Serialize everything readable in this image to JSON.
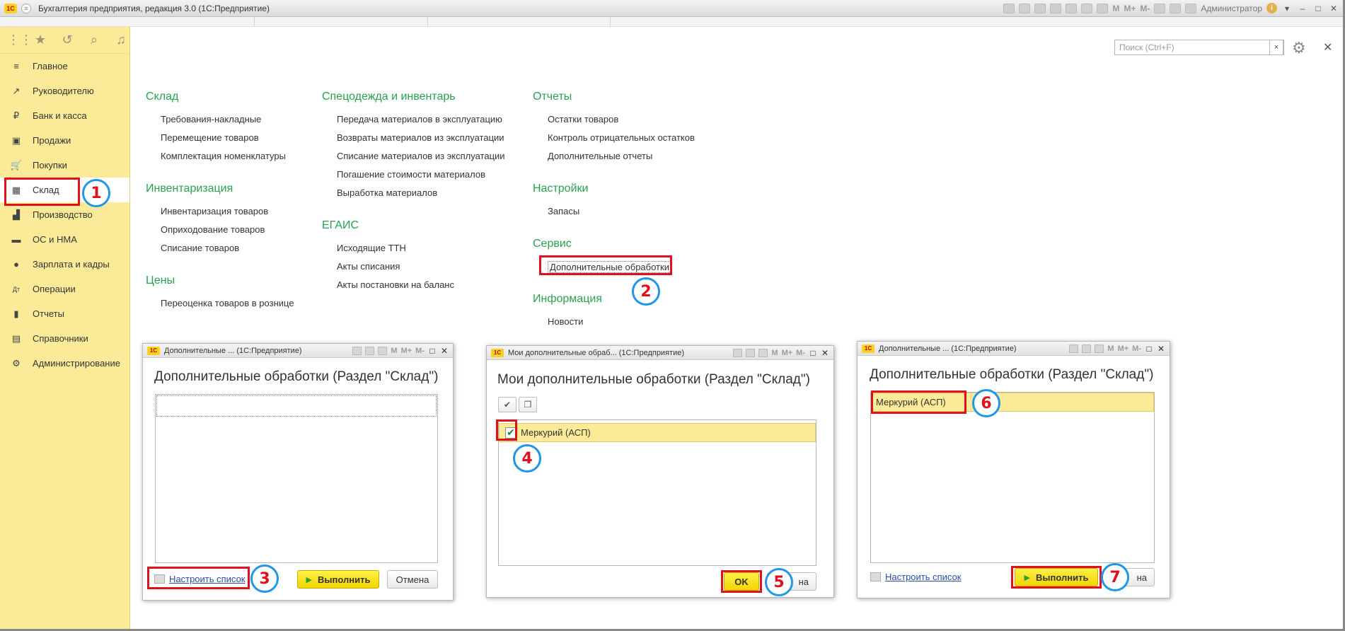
{
  "app": {
    "title": "Бухгалтерия предприятия, редакция 3.0  (1С:Предприятие)",
    "user": "Администратор",
    "logo": "1С",
    "toolbar_m": [
      "M",
      "M+",
      "M-"
    ]
  },
  "search": {
    "placeholder": "Поиск (Ctrl+F)",
    "clear": "×"
  },
  "sidebar": {
    "items": [
      {
        "label": "Главное",
        "icon": "≡"
      },
      {
        "label": "Руководителю",
        "icon": "↗"
      },
      {
        "label": "Банк и касса",
        "icon": "₽"
      },
      {
        "label": "Продажи",
        "icon": "▣"
      },
      {
        "label": "Покупки",
        "icon": "🛒"
      },
      {
        "label": "Склад",
        "icon": "▦"
      },
      {
        "label": "Производство",
        "icon": "▟"
      },
      {
        "label": "ОС и НМА",
        "icon": "▬"
      },
      {
        "label": "Зарплата и кадры",
        "icon": "●"
      },
      {
        "label": "Операции",
        "icon": "Дт"
      },
      {
        "label": "Отчеты",
        "icon": "▮"
      },
      {
        "label": "Справочники",
        "icon": "▤"
      },
      {
        "label": "Администрирование",
        "icon": "⚙"
      }
    ]
  },
  "menu": {
    "sklad": {
      "title": "Склад",
      "links": [
        "Требования-накладные",
        "Перемещение товаров",
        "Комплектация номенклатуры"
      ]
    },
    "inventar": {
      "title": "Инвентаризация",
      "links": [
        "Инвентаризация товаров",
        "Оприходование товаров",
        "Списание товаров"
      ]
    },
    "ceny": {
      "title": "Цены",
      "links": [
        "Переоценка товаров в рознице"
      ]
    },
    "specodezhda": {
      "title": "Спецодежда и инвентарь",
      "links": [
        "Передача материалов в эксплуатацию",
        "Возвраты материалов из эксплуатации",
        "Списание материалов из эксплуатации",
        "Погашение стоимости материалов",
        "Выработка материалов"
      ]
    },
    "egais": {
      "title": "ЕГАИС",
      "links": [
        "Исходящие ТТН",
        "Акты списания",
        "Акты постановки на баланс"
      ]
    },
    "otchety": {
      "title": "Отчеты",
      "links": [
        "Остатки товаров",
        "Контроль отрицательных остатков",
        "Дополнительные отчеты"
      ]
    },
    "nastroiki": {
      "title": "Настройки",
      "links": [
        "Запасы"
      ]
    },
    "servis": {
      "title": "Сервис",
      "links": [
        "Дополнительные обработки"
      ]
    },
    "info": {
      "title": "Информация",
      "links": [
        "Новости"
      ]
    }
  },
  "steps": [
    "1",
    "2",
    "3",
    "4",
    "5",
    "6",
    "7"
  ],
  "dialog1": {
    "window_title": "Дополнительные ...  (1С:Предприятие)",
    "heading": "Дополнительные обработки (Раздел \"Склад\")",
    "link": "Настроить список",
    "run_button": "Выполнить",
    "cancel_button": "Отмена"
  },
  "dialog2": {
    "window_title": "Мои дополнительные обраб...  (1С:Предприятие)",
    "heading": "Мои дополнительные обработки (Раздел \"Склад\")",
    "row": "Меркурий (АСП)",
    "checked": true,
    "ok_button": "OK",
    "cancel_partial": "на"
  },
  "dialog3": {
    "window_title": "Дополнительные ...  (1С:Предприятие)",
    "heading": "Дополнительные обработки (Раздел \"Склад\")",
    "row": "Меркурий (АСП)",
    "link": "Настроить список",
    "run_button": "Выполнить",
    "cancel_partial": "на"
  },
  "colors": {
    "sidebar_bg": "#fbeb99",
    "section_green": "#27a251",
    "highlight_red": "#e0111b",
    "step_circle_blue": "#2196e6",
    "primary_button_yellow": "#f1d600"
  }
}
